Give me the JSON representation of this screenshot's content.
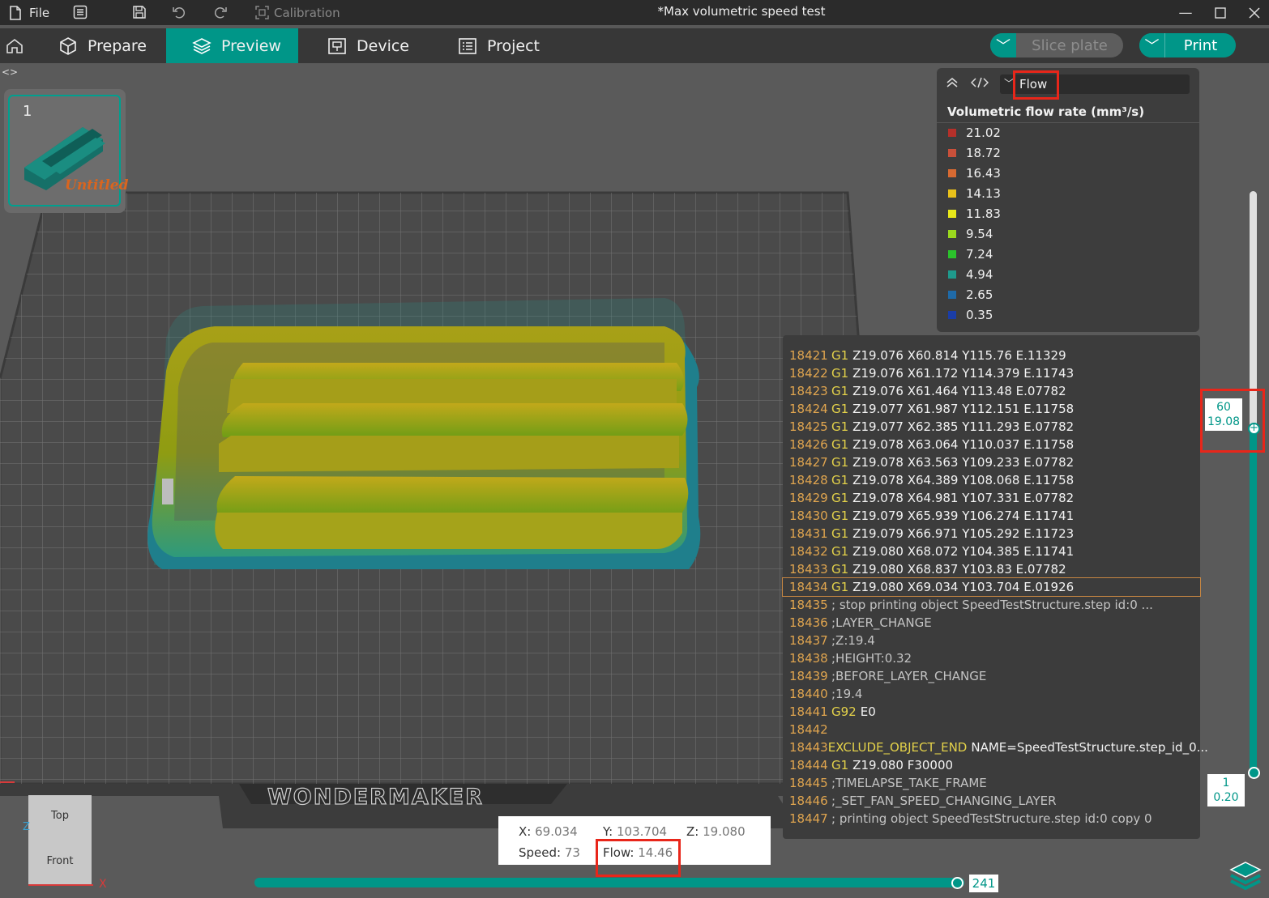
{
  "titlebar": {
    "file_label": "File",
    "calibration_label": "Calibration",
    "window_title": "*Max volumetric speed test"
  },
  "menubar": {
    "tabs": [
      {
        "label": "Prepare"
      },
      {
        "label": "Preview"
      },
      {
        "label": "Device"
      },
      {
        "label": "Project"
      }
    ],
    "slice_label": "Slice plate",
    "print_label": "Print"
  },
  "plate": {
    "number": "1",
    "name": "Untitled"
  },
  "bed": {
    "brand": "WONDERMAKER"
  },
  "legend": {
    "view_mode": "Flow",
    "title": "Volumetric flow rate (mm³/s)",
    "items": [
      {
        "value": "21.02",
        "color": "#b5302a"
      },
      {
        "value": "18.72",
        "color": "#c9503a"
      },
      {
        "value": "16.43",
        "color": "#d86a32"
      },
      {
        "value": "14.13",
        "color": "#e9c11a"
      },
      {
        "value": "11.83",
        "color": "#e8e81a"
      },
      {
        "value": "9.54",
        "color": "#9ad81e"
      },
      {
        "value": "7.24",
        "color": "#2bc22b"
      },
      {
        "value": "4.94",
        "color": "#1f9a8d"
      },
      {
        "value": "2.65",
        "color": "#1f6aa8"
      },
      {
        "value": "0.35",
        "color": "#1b3da6"
      }
    ]
  },
  "gcode": {
    "lines": [
      {
        "num": "18421",
        "cmd": "G1",
        "args": "Z19.076 X60.814 Y115.76 E.11329"
      },
      {
        "num": "18422",
        "cmd": "G1",
        "args": "Z19.076 X61.172 Y114.379 E.11743"
      },
      {
        "num": "18423",
        "cmd": "G1",
        "args": "Z19.076 X61.464 Y113.48 E.07782"
      },
      {
        "num": "18424",
        "cmd": "G1",
        "args": "Z19.077 X61.987 Y112.151 E.11758"
      },
      {
        "num": "18425",
        "cmd": "G1",
        "args": "Z19.077 X62.385 Y111.293 E.07782"
      },
      {
        "num": "18426",
        "cmd": "G1",
        "args": "Z19.078 X63.064 Y110.037 E.11758"
      },
      {
        "num": "18427",
        "cmd": "G1",
        "args": "Z19.078 X63.563 Y109.233 E.07782"
      },
      {
        "num": "18428",
        "cmd": "G1",
        "args": "Z19.078 X64.389 Y108.068 E.11758"
      },
      {
        "num": "18429",
        "cmd": "G1",
        "args": "Z19.078 X64.981 Y107.331 E.07782"
      },
      {
        "num": "18430",
        "cmd": "G1",
        "args": "Z19.079 X65.939 Y106.274 E.11741"
      },
      {
        "num": "18431",
        "cmd": "G1",
        "args": "Z19.079 X66.971 Y105.292 E.11723"
      },
      {
        "num": "18432",
        "cmd": "G1",
        "args": "Z19.080 X68.072 Y104.385 E.11741"
      },
      {
        "num": "18433",
        "cmd": "G1",
        "args": "Z19.080 X68.837 Y103.83 E.07782"
      },
      {
        "num": "18434",
        "cmd": "G1",
        "args": "Z19.080 X69.034 Y103.704 E.01926",
        "highlight": true
      },
      {
        "num": "18435",
        "cmd": "",
        "args": "",
        "comment": "; stop printing object SpeedTestStructure.step id:0 ..."
      },
      {
        "num": "18436",
        "cmd": "",
        "args": "",
        "comment": ";LAYER_CHANGE"
      },
      {
        "num": "18437",
        "cmd": "",
        "args": "",
        "comment": ";Z:19.4"
      },
      {
        "num": "18438",
        "cmd": "",
        "args": "",
        "comment": ";HEIGHT:0.32"
      },
      {
        "num": "18439",
        "cmd": "",
        "args": "",
        "comment": ";BEFORE_LAYER_CHANGE"
      },
      {
        "num": "18440",
        "cmd": "",
        "args": "",
        "comment": ";19.4"
      },
      {
        "num": "18441",
        "cmd": "G92",
        "args": "E0"
      },
      {
        "num": "18442",
        "cmd": "",
        "args": ""
      },
      {
        "num": "18443",
        "cmd": "EXCLUDE_OBJECT_END",
        "args": "NAME=SpeedTestStructure.step_id_0..."
      },
      {
        "num": "18444",
        "cmd": "G1",
        "args": "Z19.080 F30000"
      },
      {
        "num": "18445",
        "cmd": "",
        "args": "",
        "comment": ";TIMELAPSE_TAKE_FRAME"
      },
      {
        "num": "18446",
        "cmd": "",
        "args": "",
        "comment": ";_SET_FAN_SPEED_CHANGING_LAYER"
      },
      {
        "num": "18447",
        "cmd": "",
        "args": "",
        "comment": "; printing object SpeedTestStructure.step id:0 copy 0"
      }
    ]
  },
  "layer_slider": {
    "top_layer": "60",
    "top_height": "19.08",
    "bottom_layer": "1",
    "bottom_height": "0.20",
    "position_fraction": 0.4
  },
  "move_slider": {
    "value": "241"
  },
  "position": {
    "x_label": "X:",
    "x": "69.034",
    "y_label": "Y:",
    "y": "103.704",
    "z_label": "Z:",
    "z": "19.080",
    "speed_label": "Speed:",
    "speed": "73",
    "flow_label": "Flow:",
    "flow": "14.46"
  },
  "navcube": {
    "top": "Top",
    "front": "Front",
    "axis_x": "X",
    "axis_z": "Z"
  }
}
